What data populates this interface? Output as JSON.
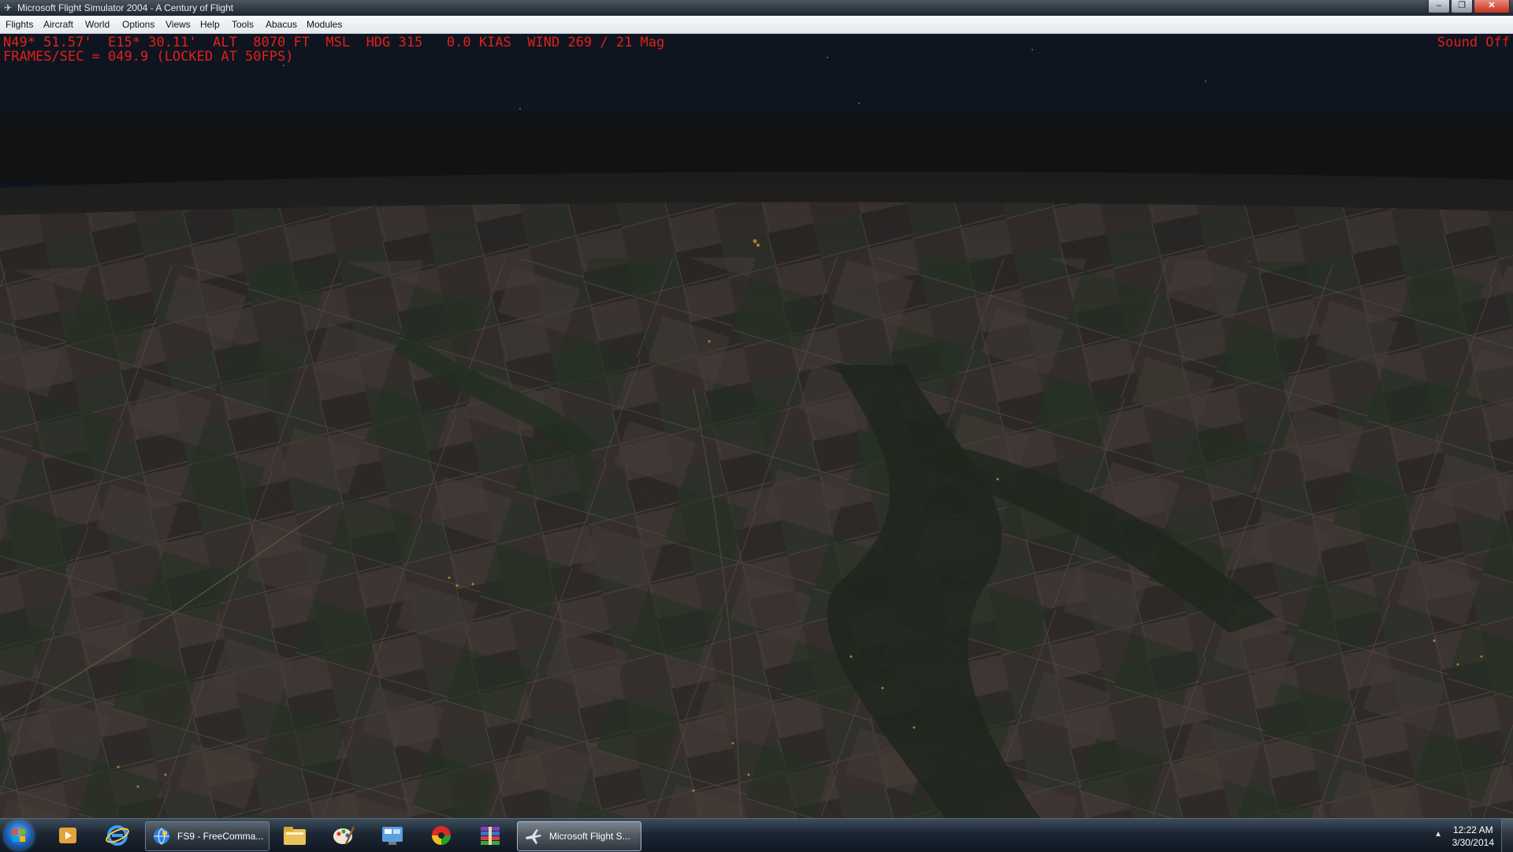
{
  "window": {
    "title": "Microsoft Flight Simulator 2004 - A Century of Flight",
    "icon": "airplane-icon",
    "controls": [
      "minimize-icon",
      "maximize-icon",
      "close-icon"
    ],
    "control_glyphs": {
      "minimize": "–",
      "maximize": "❐",
      "close": "✕"
    }
  },
  "menu": {
    "items": [
      "Flights",
      "Aircraft",
      "World",
      "Options",
      "Views",
      "Help",
      "Tools",
      "Abacus",
      "Modules"
    ]
  },
  "hud": {
    "line1": "N49* 51.57'  E15* 30.11'  ALT  8070 FT  MSL  HDG 315   0.0 KIAS  WIND 269 / 21 Mag",
    "line2": "FRAMES/SEC = 049.9 (LOCKED AT 50FPS)",
    "sound": "Sound Off",
    "color": "#e0201a"
  },
  "taskbar": {
    "start_icon": "windows-start-icon",
    "pinned": [
      "media-player-icon",
      "internet-explorer-icon"
    ],
    "tasks": [
      {
        "label": "FS9 - FreeComma...",
        "icon": "globe-icon",
        "active": false
      },
      {
        "label": "Microsoft Flight S...",
        "icon": "airplane-icon",
        "active": true
      }
    ],
    "quick_icons": [
      "file-explorer-icon",
      "paint-icon",
      "control-panel-icon",
      "color-wheel-icon",
      "archive-icon"
    ],
    "tray_arrow": "▲",
    "clock": {
      "time": "12:22 AM",
      "date": "3/30/2014"
    }
  }
}
